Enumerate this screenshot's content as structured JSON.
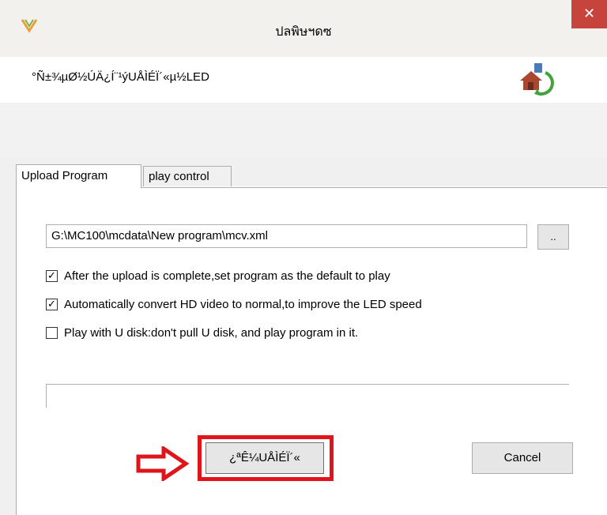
{
  "window": {
    "title": "ปลพิษฯดซ",
    "close_label": "✕"
  },
  "header": {
    "subtitle": "°Ñ±¾µØ½ÚÄ¿Í¨¹ýUÅÌÉÏ´«µ½LED"
  },
  "tabs": [
    {
      "label": "Upload Program",
      "active": true
    },
    {
      "label": "play control",
      "active": false
    }
  ],
  "upload": {
    "path_value": "G:\\MC100\\mcdata\\New program\\mcv.xml",
    "browse_label": "..",
    "options": [
      {
        "label": "After the upload is complete,set program as the default to play",
        "checked": true,
        "mark": "✓"
      },
      {
        "label": "Automatically convert HD video to normal,to improve the LED speed",
        "checked": true,
        "mark": "✓"
      },
      {
        "label": "Play with U disk:don't pull U disk, and play program in it.",
        "checked": false,
        "mark": ""
      }
    ],
    "progress": 0,
    "upload_button_label": "¿ªÊ¼UÅÌÉÏ´«",
    "cancel_button_label": "Cancel"
  },
  "colors": {
    "close_bg": "#c6443b",
    "highlight": "#e0141b"
  }
}
